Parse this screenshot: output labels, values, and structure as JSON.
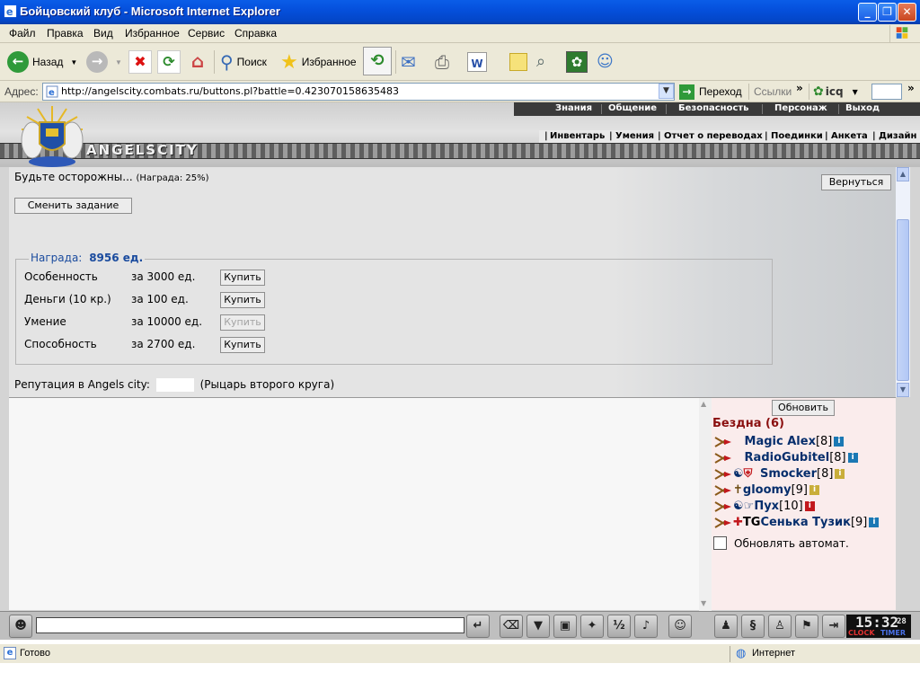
{
  "window": {
    "title": "Бойцовский клуб - Microsoft Internet Explorer",
    "minimize_icon": "minimize-icon",
    "restore_icon": "restore-icon",
    "close_icon": "close-icon"
  },
  "menu": [
    "Файл",
    "Правка",
    "Вид",
    "Избранное",
    "Сервис",
    "Справка"
  ],
  "toolbar": {
    "back_label": "Назад",
    "search_label": "Поиск",
    "favorites_label": "Избранное"
  },
  "address": {
    "label": "Адрес:",
    "url": "http://angelscity.combats.ru/buttons.pl?battle=0.423070158635483",
    "go_label": "Переход",
    "links_label": "Ссылки",
    "icq_label": "icq"
  },
  "game": {
    "brand": "ANGELSCITY",
    "top_nav": [
      "Знания",
      "Общение",
      "Безопасность",
      "Персонаж",
      "Выход"
    ],
    "sub_nav": [
      "Инвентарь",
      "Умения",
      "Отчет о переводах",
      "Поединки",
      "Анкета",
      "Дизайн"
    ],
    "warning": "Будьте осторожны...",
    "reward_pct": "(Награда: 25%)",
    "back_button": "Вернуться",
    "change_task_button": "Сменить задание",
    "reward_label": "Награда:",
    "reward_value": "8956 ед.",
    "shop_items": [
      {
        "name": "Особенность",
        "price": "за 3000 ед.",
        "button": "Купить",
        "enabled": true
      },
      {
        "name": "Деньги (10 кр.)",
        "price": "за 100 ед.",
        "button": "Купить",
        "enabled": true
      },
      {
        "name": "Умение",
        "price": "за 10000 ед.",
        "button": "Купить",
        "enabled": false
      },
      {
        "name": "Способность",
        "price": "за 2700 ед.",
        "button": "Купить",
        "enabled": true
      }
    ],
    "reputation_label": "Репутация в Angels city:",
    "reputation_rank": "(Рыцарь второго круга)",
    "refresh_button": "Обновить",
    "location_title": "Бездна (6)",
    "users": [
      {
        "name": "Magic Alex",
        "level": "[8]",
        "info": "blue"
      },
      {
        "name": "RadioGubitel",
        "level": "[8]",
        "info": "blue"
      },
      {
        "name": "Smocker",
        "level": "[8]",
        "info": "yellow"
      },
      {
        "name": "gloomy",
        "level": "[9]",
        "info": "yellow"
      },
      {
        "name": "Пух",
        "level": "[10]",
        "info": "red"
      },
      {
        "name": "Сенька Тузик",
        "level": "[9]",
        "info": "blue"
      }
    ],
    "auto_refresh_label": "Обновлять автомат.",
    "clock_time": "15:32",
    "clock_sec": "28",
    "clock_label": "CLOCK",
    "timer_label": "TIMER"
  },
  "status": {
    "left": "Готово",
    "zone": "Интернет"
  },
  "colors": {
    "titlebar": "#0550dc",
    "link_blue": "#062e6c",
    "location_red": "#8a0f0f"
  }
}
